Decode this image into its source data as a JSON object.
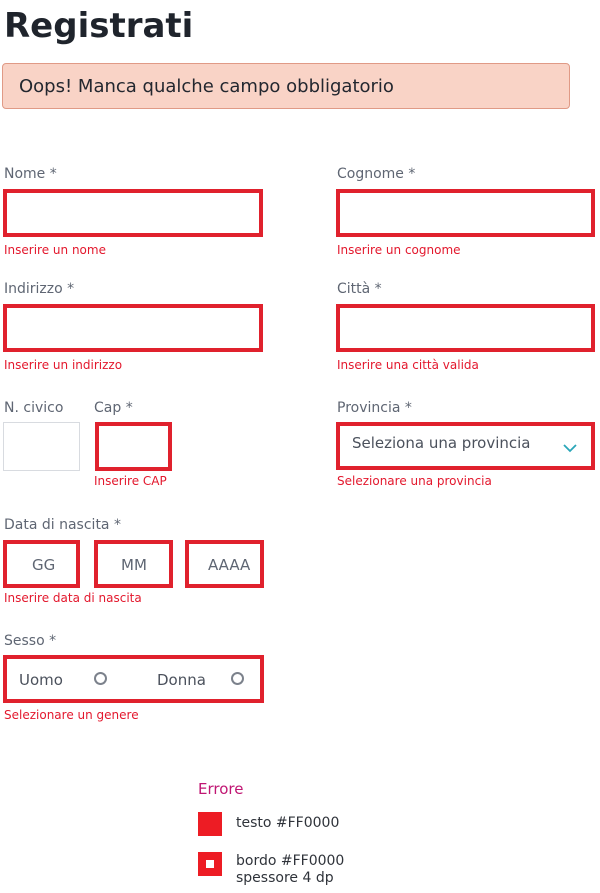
{
  "page": {
    "title": "Registrati"
  },
  "alert": {
    "text": "Oops! Manca qualche campo obbligatorio"
  },
  "form": {
    "nome": {
      "label": "Nome *",
      "error": "Inserire un nome"
    },
    "cognome": {
      "label": "Cognome *",
      "error": "Inserire un cognome"
    },
    "indirizzo": {
      "label": "Indirizzo *",
      "error": "Inserire un indirizzo"
    },
    "citta": {
      "label": "Città *",
      "error": "Inserire una città valida"
    },
    "civico": {
      "label": "N. civico"
    },
    "cap": {
      "label": "Cap *",
      "error": "Inserire CAP"
    },
    "provincia": {
      "label": "Provincia *",
      "selected": "Seleziona una provincia",
      "error": "Selezionare una provincia"
    },
    "nascita": {
      "label": "Data di nascita *",
      "dd": "GG",
      "mm": "MM",
      "yyyy": "AAAA",
      "error": "Inserire data di nascita"
    },
    "sesso": {
      "label": "Sesso *",
      "option1": "Uomo",
      "option2": "Donna",
      "error": "Selezionare un genere"
    }
  },
  "legend": {
    "title": "Errore",
    "text_item": "testo #FF0000",
    "border_line1": "bordo #FF0000",
    "border_line2": "spessore 4 dp"
  },
  "colors": {
    "error": "#FF0000",
    "alert_bg": "#f9d3c6",
    "legend_title": "#c01673",
    "chevron": "#2aa6b8"
  }
}
